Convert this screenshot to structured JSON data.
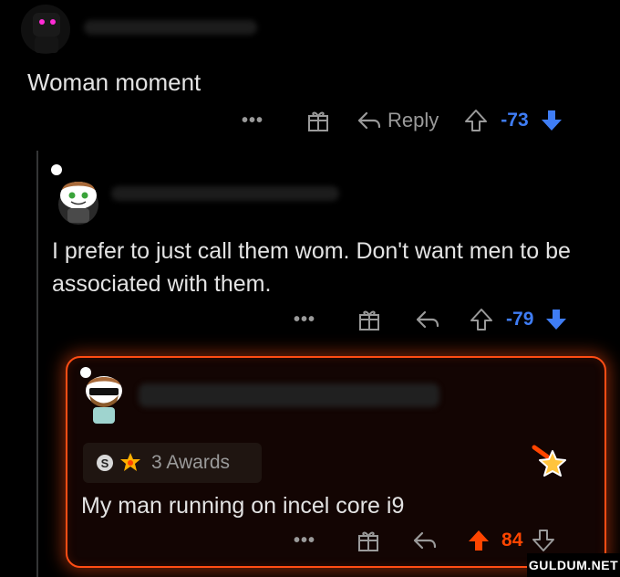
{
  "comment1": {
    "text": "Woman moment",
    "reply_label": "Reply",
    "score": "-73"
  },
  "comment2": {
    "text": "I prefer to just call them wom. Don't want men to be associated with them.",
    "score": "-79"
  },
  "comment3": {
    "awards_label": "3 Awards",
    "text": "My man running on incel core i9",
    "score": "84"
  },
  "watermark": "GULDUM.NET",
  "colors": {
    "downvote": "#3f7df5",
    "upvote": "#ff4500",
    "highlight_border": "#ff4d14",
    "text": "#e3e3e3",
    "muted": "#9a9a9a"
  },
  "icons": {
    "more": "ellipsis-icon",
    "gift": "gift-icon",
    "reply": "reply-arrow-icon",
    "upvote": "upvote-arrow-icon",
    "downvote": "downvote-arrow-icon",
    "award": "star-award-icon"
  }
}
